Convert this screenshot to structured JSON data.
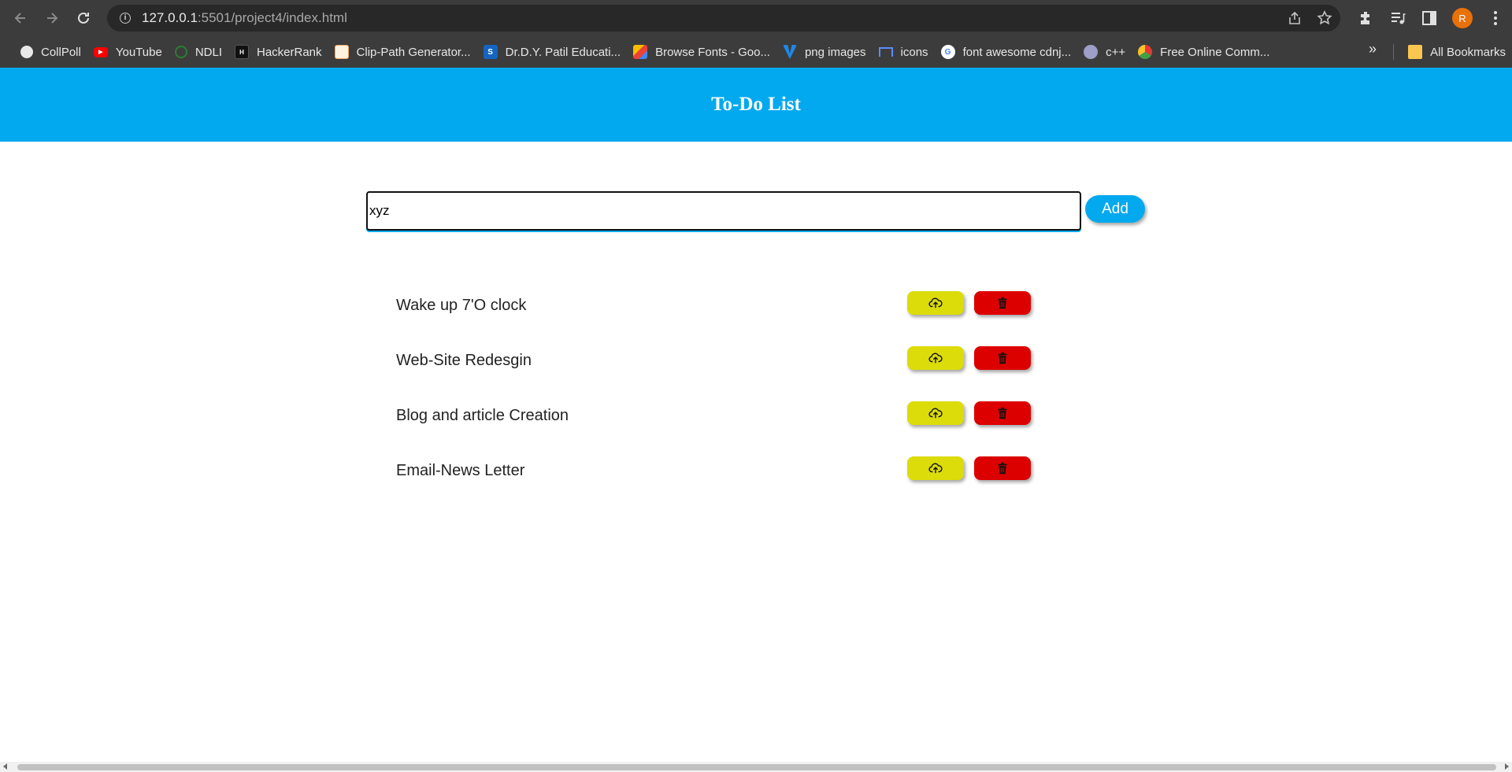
{
  "browser": {
    "url_host": "127.0.0.1",
    "url_rest": ":5501/project4/index.html",
    "avatar_letter": "R",
    "bookmarks": [
      {
        "label": "CollPoll",
        "icon": "globe-icon",
        "color": "#e8e8e8"
      },
      {
        "label": "YouTube",
        "icon": "youtube-icon",
        "color": "#ff0000"
      },
      {
        "label": "NDLI",
        "icon": "ndli-icon",
        "color": "#2e7d32"
      },
      {
        "label": "HackerRank",
        "icon": "hackerrank-icon",
        "color": "#111111"
      },
      {
        "label": "Clip-Path Generator...",
        "icon": "clippath-icon",
        "color": "#f4a460"
      },
      {
        "label": "Dr.D.Y. Patil Educati...",
        "icon": "s-icon",
        "color": "#1565c0"
      },
      {
        "label": "Browse Fonts - Goo...",
        "icon": "google-fonts-icon",
        "color": "#4285f4"
      },
      {
        "label": "png images",
        "icon": "png-icon",
        "color": "#1e88e5"
      },
      {
        "label": "icons",
        "icon": "flag-icon",
        "color": "#5c8df6"
      },
      {
        "label": "font awesome cdnj...",
        "icon": "google-icon",
        "color": "#ffffff"
      },
      {
        "label": "c++",
        "icon": "cpp-icon",
        "color": "#9e9ec8"
      },
      {
        "label": "Free Online Comm...",
        "icon": "colorful-icon",
        "color": "#e53935"
      }
    ],
    "overflow": "»",
    "all_bookmarks": "All Bookmarks"
  },
  "app": {
    "title": "To-Do List",
    "input_value": "xyz",
    "add_label": "Add",
    "accent": "#03a9ee",
    "update_color": "#dcdc0a",
    "delete_color": "#dd0000",
    "items": [
      {
        "text": "Wake up 7'O clock"
      },
      {
        "text": "Web-Site Redesgin"
      },
      {
        "text": "Blog and article Creation"
      },
      {
        "text": "Email-News Letter"
      }
    ]
  }
}
